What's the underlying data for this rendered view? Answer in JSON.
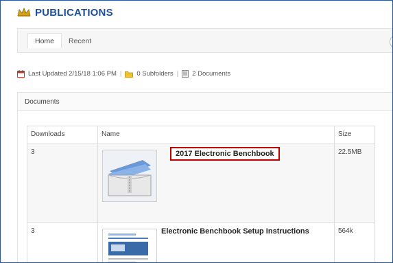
{
  "title": "PUBLICATIONS",
  "tabs": [
    {
      "label": "Home"
    },
    {
      "label": "Recent"
    }
  ],
  "meta": {
    "last_updated": "Last Updated 2/15/18 1:06 PM",
    "subfolders": "0 Subfolders",
    "documents": "2 Documents"
  },
  "panel": {
    "heading": "Documents"
  },
  "table": {
    "headers": [
      "Downloads",
      "Name",
      "Size"
    ],
    "rows": [
      {
        "downloads": "3",
        "name": "2017 Electronic Benchbook",
        "size": "22.5MB",
        "icon": "zip-archive-icon"
      },
      {
        "downloads": "3",
        "name": "Electronic Benchbook Setup Instructions",
        "size": "564k",
        "icon": "document-thumbnail-icon"
      }
    ]
  },
  "colors": {
    "brand": "#1f4f9e",
    "highlight": "#c00000"
  }
}
